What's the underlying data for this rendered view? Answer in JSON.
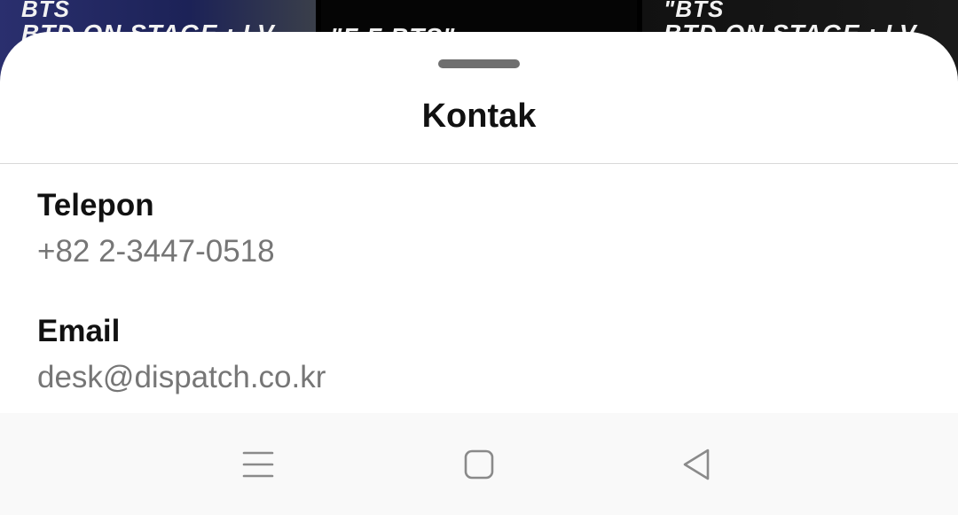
{
  "background": {
    "thumbnails": [
      {
        "line1": "BTS",
        "line2": "BTD ON STAGE : LV"
      },
      {
        "line1": "",
        "line2": "\"F            F         BTS\""
      },
      {
        "line1": "\"BTS",
        "line2": "BTD ON STAGE : LV"
      }
    ]
  },
  "sheet": {
    "title": "Kontak",
    "phone": {
      "label": "Telepon",
      "value": "+82 2-3447-0518"
    },
    "email": {
      "label": "Email",
      "value": "desk@dispatch.co.kr"
    }
  },
  "navbar": {
    "icons": [
      "menu-icon",
      "home-square-icon",
      "back-triangle-icon"
    ],
    "icon_color": "#8a8a8a"
  },
  "colors": {
    "sheet_bg": "#ffffff",
    "title": "#111111",
    "value_text": "#767676",
    "navbar_bg": "#f9f9f9"
  }
}
